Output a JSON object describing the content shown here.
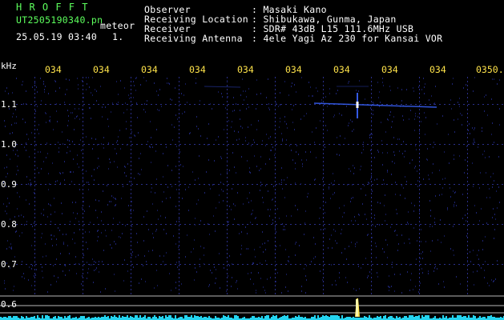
{
  "header": {
    "title": "H R O F F T",
    "filename": "UT2505190340.pn",
    "type": "meteor",
    "datetime": "25.05.19 03:40",
    "count": "1.",
    "info_labels": [
      "Observer",
      "Receiving Location",
      "Receiver",
      "Receiving Antenna"
    ],
    "info_values": [
      ": Masaki Kano",
      ": Shibukawa, Gunma, Japan",
      ": SDR# 43dB L15 111.6MHz USB",
      ": 4ele Yagi Az 230 for Kansai VOR"
    ]
  },
  "axis": {
    "unit": "kHz",
    "y_ticks": [
      "1.1",
      "1.0",
      "0.9",
      "0.8",
      "0.7",
      "0.6"
    ],
    "time_ticks": [
      "034",
      "034",
      "034",
      "034",
      "034",
      "034",
      "034",
      "034",
      "034",
      "0350."
    ]
  },
  "colors": {
    "background": "#000000",
    "grid_dot": "#2a2f8a",
    "signal": "#3a64ff",
    "bright": "#ffffff",
    "spike": "#ffe34a",
    "baseline": "#24d4f0",
    "guide_lines": "#b8b8b8"
  }
}
